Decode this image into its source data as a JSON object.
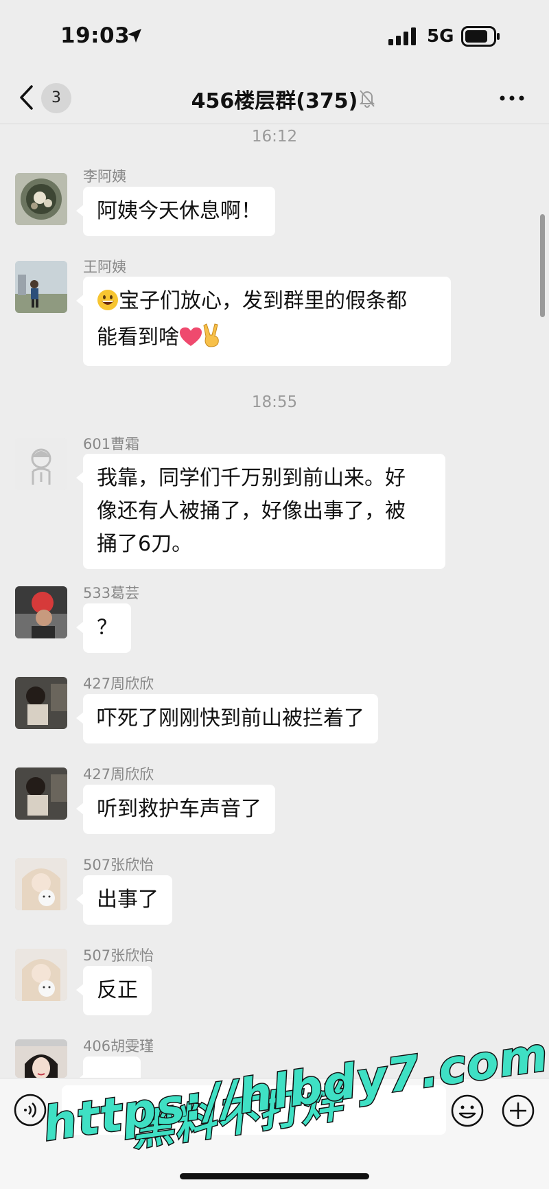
{
  "status_bar": {
    "time": "19:03",
    "network": "5G",
    "icons": [
      "location-arrow-icon",
      "cellular-signal-icon",
      "battery-icon"
    ]
  },
  "nav": {
    "back_icon": "chevron-left-icon",
    "unread_count": "3",
    "title": "456楼层群(375)",
    "mute_icon": "bell-muted-icon",
    "more_icon": "ellipsis-icon"
  },
  "timestamps": [
    "16:12",
    "18:55"
  ],
  "messages": [
    {
      "sender": "李阿姨",
      "text": "阿姨今天休息啊！"
    },
    {
      "sender": "王阿姨",
      "line1_prefix_emoji": "grinning-face-emoji",
      "line1": "宝子们放心，发到群里的假条都",
      "line2": "能看到啥",
      "line2_suffix_emojis": [
        "red-heart-emoji",
        "victory-hand-emoji"
      ]
    },
    {
      "sender": "601曹霜",
      "line1": "我靠，同学们千万别到前山来。好",
      "line2": "像还有人被捅了，好像出事了，被",
      "line3": "捅了6刀。"
    },
    {
      "sender": "533葛芸",
      "text": "？"
    },
    {
      "sender": "427周欣欣",
      "text": "吓死了刚刚快到前山被拦着了"
    },
    {
      "sender": "427周欣欣",
      "text": "听到救护车声音了"
    },
    {
      "sender": "507张欣怡",
      "text": "出事了"
    },
    {
      "sender": "507张欣怡",
      "text": "反正"
    },
    {
      "sender": "406胡雯瑾",
      "text": ""
    }
  ],
  "input_bar": {
    "voice_icon": "voice-input-icon",
    "emoji_icon": "smiley-face-icon",
    "plus_icon": "plus-circle-icon"
  },
  "watermark": {
    "line1": "黑料不打烊",
    "line2": "https://hlbdy7.com"
  },
  "colors": {
    "background": "#ededed",
    "bubble": "#ffffff",
    "watermark_fill": "#3fe0c4"
  }
}
